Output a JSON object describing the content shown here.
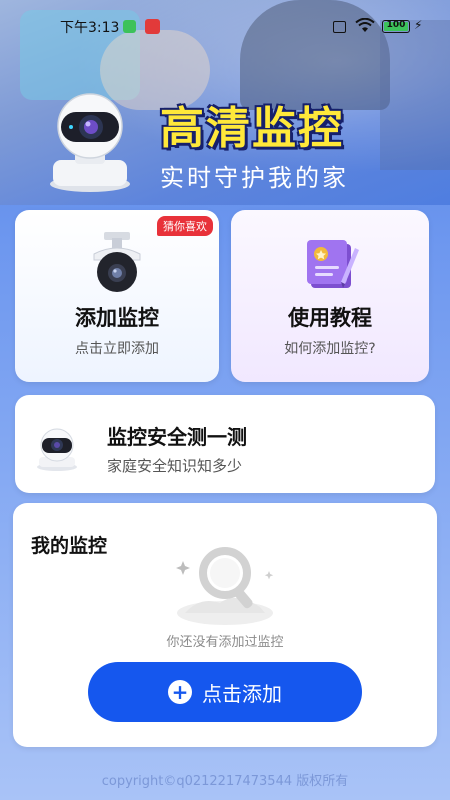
{
  "status_bar": {
    "time": "下午3:13",
    "battery": "100"
  },
  "hero": {
    "title": "高清监控",
    "subtitle": "实时守护我的家"
  },
  "cards": {
    "add": {
      "badge": "猜你喜欢",
      "title": "添加监控",
      "desc": "点击立即添加"
    },
    "tutorial": {
      "title": "使用教程",
      "desc": "如何添加监控?"
    },
    "test": {
      "title": "监控安全测一测",
      "desc": "家庭安全知识知多少"
    }
  },
  "my_monitors": {
    "title": "我的监控",
    "empty_text": "你还没有添加过监控",
    "add_button": "点击添加"
  },
  "footer": {
    "copyright": "copyright©q0212217473544 版权所有"
  },
  "colors": {
    "accent": "#1557ee",
    "badge": "#e8323a",
    "hero_title": "#ffe83a"
  }
}
